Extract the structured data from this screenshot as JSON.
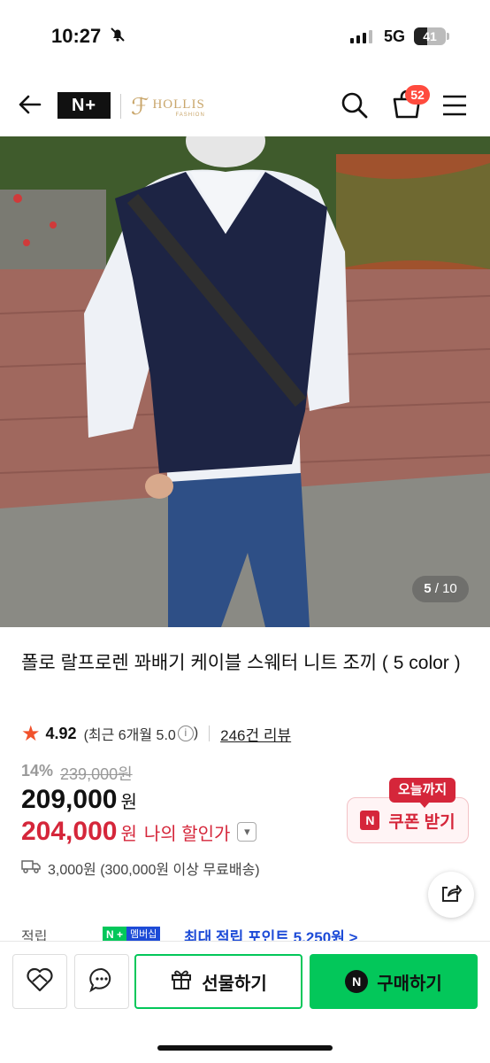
{
  "status_bar": {
    "time": "10:27",
    "network": "5G",
    "battery": "41",
    "battery_level": 0.41,
    "icons": [
      "mute-bell-icon",
      "signal-icon",
      "battery-icon"
    ]
  },
  "header": {
    "logo_text": "N+",
    "brand": "HOLLIS",
    "brand_sub": "FASHION",
    "cart_count": "52",
    "icons": [
      "back-arrow-icon",
      "search-icon",
      "cart-icon",
      "menu-icon"
    ]
  },
  "gallery": {
    "current": "5",
    "total": "/ 10"
  },
  "product": {
    "title": "폴로 랄프로렌 꽈배기 케이블 스웨터 니트 조끼 ( 5 color )",
    "rating": "4.92",
    "recent_rating": "(최근 6개월 5.0",
    "recent_rating_end": ")",
    "review_count": "246건 리뷰",
    "discount_pct": "14%",
    "original_price": "239,000원",
    "price": "209,000",
    "price_unit": "원",
    "my_price": "204,000",
    "my_price_unit": "원",
    "my_price_label": "나의 할인가",
    "coupon_badge": "오늘까지",
    "coupon_label": "쿠폰 받기",
    "shipping": "3,000원 (300,000원 이상 무료배송)",
    "points_label": "적립",
    "membership_badge_1": "N +",
    "membership_badge_2": "멤버십",
    "points_max": "최대 적립 포인트 5,250원 >"
  },
  "bottom_bar": {
    "gift_label": "선물하기",
    "buy_label": "구매하기",
    "buy_icon": "N"
  },
  "colors": {
    "accent_green": "#03c75a",
    "discount_red": "#d5263a",
    "star": "#f1522c",
    "badge": "#ff4b3e"
  }
}
